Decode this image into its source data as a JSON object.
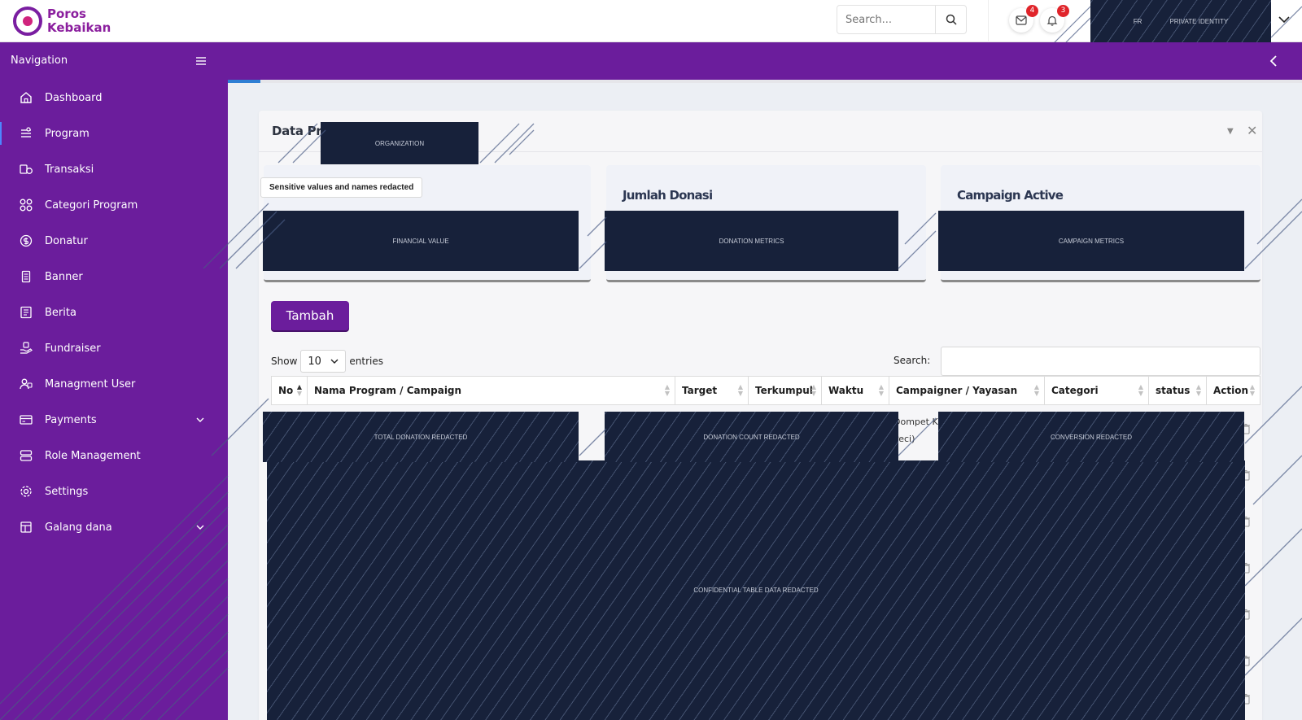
{
  "brand": {
    "name_line1": "Poros",
    "name_line2": "Kebaikan"
  },
  "header": {
    "search_placeholder": "Search...",
    "messages_count": "4",
    "notifications_count": "3",
    "profile_initials": "FR",
    "profile_redaction": "PRIVATE IDENTITY"
  },
  "sidebar": {
    "title": "Navigation",
    "items": [
      {
        "label": "Dashboard",
        "icon": "home-icon"
      },
      {
        "label": "Program",
        "icon": "list-icon"
      },
      {
        "label": "Transaksi",
        "icon": "coins-icon"
      },
      {
        "label": "Categori Program",
        "icon": "grid-icon"
      },
      {
        "label": "Donatur",
        "icon": "dollar-icon"
      },
      {
        "label": "Banner",
        "icon": "document-icon"
      },
      {
        "label": "Berita",
        "icon": "news-icon"
      },
      {
        "label": "Fundraiser",
        "icon": "hand-icon"
      },
      {
        "label": "Managment User",
        "icon": "users-icon"
      },
      {
        "label": "Payments",
        "icon": "card-icon"
      },
      {
        "label": "Role Management",
        "icon": "server-icon"
      },
      {
        "label": "Settings",
        "icon": "gear-icon"
      },
      {
        "label": "Galang dana",
        "icon": "layout-icon"
      }
    ]
  },
  "page": {
    "progress_fraction": 0.03,
    "card_title": "Data Pr",
    "org_redaction": "ORGANIZATION",
    "redaction_note": "Sensitive values and names redacted",
    "stats": [
      {
        "title": "",
        "redaction": "FINANCIAL VALUE"
      },
      {
        "title": "Jumlah Donasi",
        "redaction": "DONATION METRICS"
      },
      {
        "title": "Campaign Active",
        "redaction": "CAMPAIGN METRICS"
      }
    ],
    "add_button": "Tambah"
  },
  "table": {
    "show_label": "Show",
    "page_size": "10",
    "entries_label": "entries",
    "search_label": "Search:",
    "columns": [
      "No",
      "Nama Program / Campaign",
      "Target",
      "Terkumpul",
      "Waktu",
      "Campaigner / Yayasan",
      "Categori",
      "status",
      "Action"
    ],
    "partial_cell_line1": "Dompet K",
    "partial_cell_line2": "Peci)",
    "redactions": {
      "total": "TOTAL DONATION REDACTED",
      "count": "DONATION COUNT REDACTED",
      "conversion": "CONVERSION REDACTED",
      "table": "CONFIDENTIAL TABLE DATA REDACTED"
    }
  }
}
